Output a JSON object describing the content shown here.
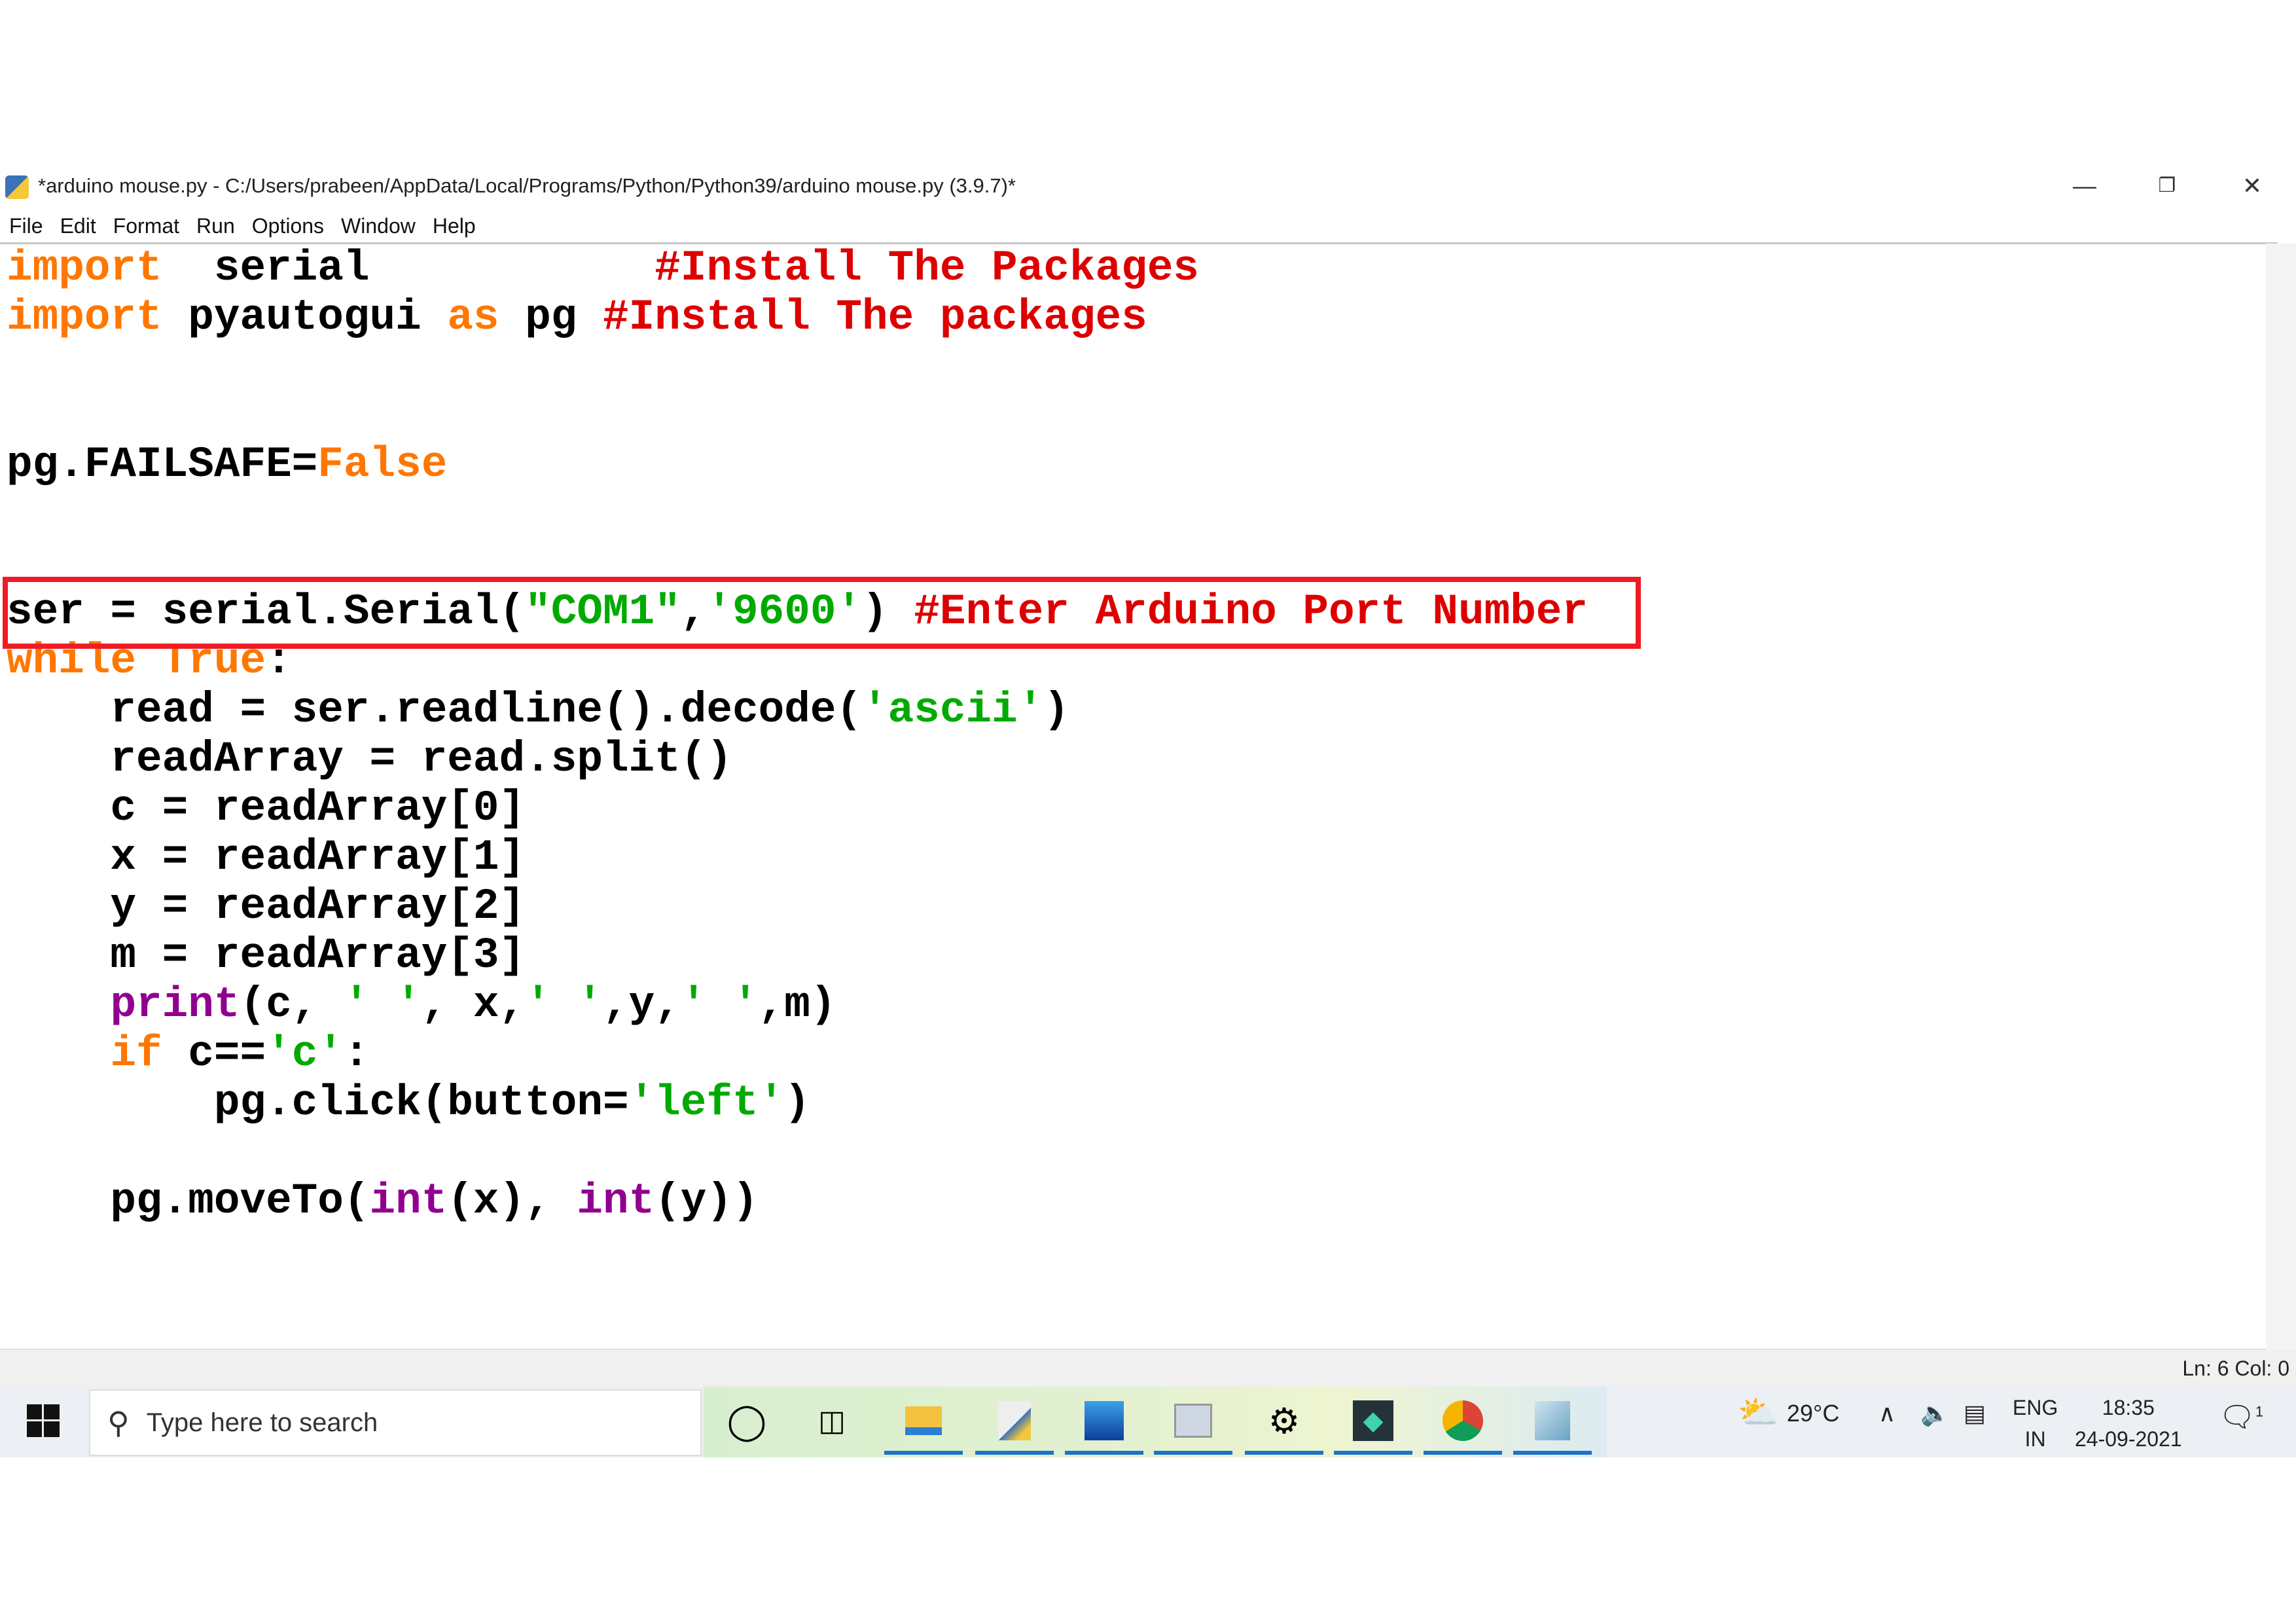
{
  "window": {
    "title": "*arduino mouse.py - C:/Users/prabeen/AppData/Local/Programs/Python/Python39/arduino mouse.py (3.9.7)*",
    "controls": {
      "minimize": "—",
      "restore": "❐",
      "close": "✕"
    }
  },
  "menu": [
    "File",
    "Edit",
    "Format",
    "Run",
    "Options",
    "Window",
    "Help"
  ],
  "code": [
    [
      [
        "kw",
        "import"
      ],
      [
        "",
        "  serial           "
      ],
      [
        "cm",
        "#Install The Packages"
      ]
    ],
    [
      [
        "kw",
        "import"
      ],
      [
        "",
        " pyautogui "
      ],
      [
        "kw",
        "as"
      ],
      [
        "",
        " pg "
      ],
      [
        "cm",
        "#Install The packages"
      ]
    ],
    [],
    [],
    [
      [
        "",
        "pg.FAILSAFE="
      ],
      [
        "kw",
        "False"
      ]
    ],
    [],
    [],
    [
      [
        "",
        "ser = serial.Serial("
      ],
      [
        "st",
        "\"COM1\""
      ],
      [
        "",
        ","
      ],
      [
        "st",
        "'9600'"
      ],
      [
        "",
        ") "
      ],
      [
        "cm",
        "#Enter Arduino Port Number"
      ]
    ],
    [
      [
        "kw",
        "while"
      ],
      [
        "",
        " "
      ],
      [
        "kw",
        "True"
      ],
      [
        "",
        ":"
      ]
    ],
    [
      [
        "",
        "    read = ser.readline().decode("
      ],
      [
        "st",
        "'ascii'"
      ],
      [
        "",
        ")"
      ]
    ],
    [
      [
        "",
        "    readArray = read.split()"
      ]
    ],
    [
      [
        "",
        "    c = readArray[0]"
      ]
    ],
    [
      [
        "",
        "    x = readArray[1]"
      ]
    ],
    [
      [
        "",
        "    y = readArray[2]"
      ]
    ],
    [
      [
        "",
        "    m = readArray[3]"
      ]
    ],
    [
      [
        "",
        "    "
      ],
      [
        "bi",
        "print"
      ],
      [
        "",
        "(c, "
      ],
      [
        "st",
        "' '"
      ],
      [
        "",
        ", x,"
      ],
      [
        "st",
        "' '"
      ],
      [
        "",
        ",y,"
      ],
      [
        "st",
        "' '"
      ],
      [
        "",
        ",m)"
      ]
    ],
    [
      [
        "",
        "    "
      ],
      [
        "kw",
        "if"
      ],
      [
        "",
        " c=="
      ],
      [
        "st",
        "'c'"
      ],
      [
        "",
        ":"
      ]
    ],
    [
      [
        "",
        "        pg.click(button="
      ],
      [
        "st",
        "'left'"
      ],
      [
        "",
        ")"
      ]
    ],
    [],
    [
      [
        "",
        "    pg.moveTo("
      ],
      [
        "bi",
        "int"
      ],
      [
        "",
        "(x), "
      ],
      [
        "bi",
        "int"
      ],
      [
        "",
        "(y))"
      ]
    ]
  ],
  "status": {
    "position": "Ln: 6   Col: 0"
  },
  "taskbar": {
    "search_placeholder": "Type here to search",
    "weather": "29°C",
    "lang1": "ENG",
    "lang2": "IN",
    "time": "18:35",
    "date": "24-09-2021",
    "notifications": "1"
  },
  "colors": {
    "keyword": "#ff7700",
    "comment": "#dd0000",
    "string": "#00aa00",
    "builtin": "#900090",
    "highlight_box": "#ee1c24"
  }
}
